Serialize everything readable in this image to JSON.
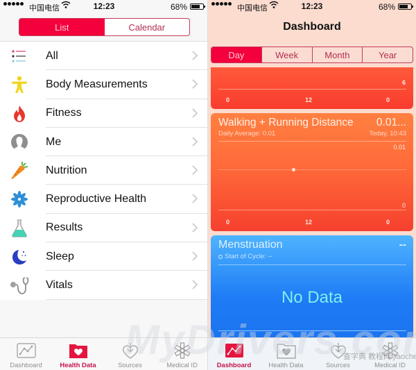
{
  "status_bar": {
    "carrier": "中国电信",
    "time": "12:23",
    "battery": "68%"
  },
  "left": {
    "segments": [
      {
        "label": "List",
        "active": true
      },
      {
        "label": "Calendar",
        "active": false
      }
    ],
    "categories": [
      {
        "label": "All",
        "icon": "list-icon"
      },
      {
        "label": "Body Measurements",
        "icon": "body-figure-icon"
      },
      {
        "label": "Fitness",
        "icon": "flame-icon"
      },
      {
        "label": "Me",
        "icon": "person-silhouette-icon"
      },
      {
        "label": "Nutrition",
        "icon": "carrot-icon"
      },
      {
        "label": "Reproductive Health",
        "icon": "snowflake-flower-icon"
      },
      {
        "label": "Results",
        "icon": "flask-icon"
      },
      {
        "label": "Sleep",
        "icon": "moon-stars-icon"
      },
      {
        "label": "Vitals",
        "icon": "stethoscope-icon"
      }
    ],
    "tabs": [
      {
        "label": "Dashboard",
        "icon": "chart-icon",
        "active": false
      },
      {
        "label": "Health Data",
        "icon": "heart-folder-icon",
        "active": true
      },
      {
        "label": "Sources",
        "icon": "heart-download-icon",
        "active": false
      },
      {
        "label": "Medical ID",
        "icon": "medical-star-icon",
        "active": false
      }
    ]
  },
  "right": {
    "title": "Dashboard",
    "segments": [
      {
        "label": "Day",
        "active": true
      },
      {
        "label": "Week",
        "active": false
      },
      {
        "label": "Month",
        "active": false
      },
      {
        "label": "Year",
        "active": false
      }
    ],
    "card1": {
      "y_max_label": "6",
      "x_labels": [
        "0",
        "12",
        "0"
      ]
    },
    "card2": {
      "title": "Walking + Running Distance",
      "value": "0.01...",
      "subtitle": "Daily Average: 0.01",
      "timestamp": "Today, 10:43",
      "y_max_label": "0.01",
      "y_min_label": "0",
      "x_labels": [
        "0",
        "12",
        "0"
      ],
      "data_point_hour": 10,
      "data_point_value": 0.01
    },
    "card3": {
      "title": "Menstruation",
      "value": "--",
      "subtitle": "Start of Cycle: --",
      "empty_text": "No Data"
    },
    "tabs": [
      {
        "label": "Dashboard",
        "icon": "chart-icon",
        "active": true
      },
      {
        "label": "Health Data",
        "icon": "heart-folder-icon",
        "active": false
      },
      {
        "label": "Sources",
        "icon": "heart-download-icon",
        "active": false
      },
      {
        "label": "Medical ID",
        "icon": "medical-star-icon",
        "active": false
      }
    ]
  },
  "watermark": {
    "main": "MyDrivers.com",
    "secondary": "查字典 教程网 jiaocheng.chazidian.com"
  },
  "colors": {
    "accent_red": "#f4003c",
    "tab_active": "#c4124a",
    "card_red": "#f93c2e",
    "card_orange": "#ff8040",
    "card_blue": "#1e7cf5",
    "no_data": "#7ff0ef"
  }
}
